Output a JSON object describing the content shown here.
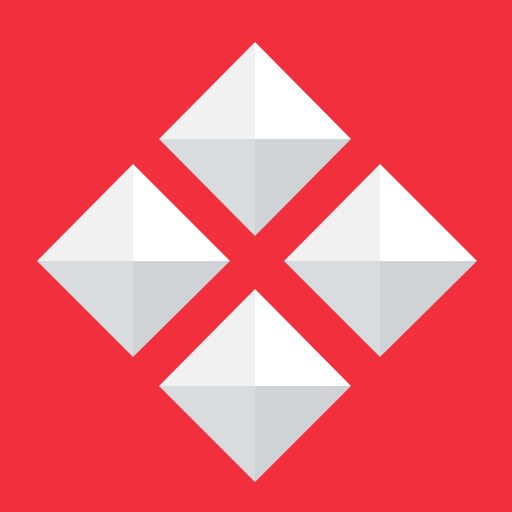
{
  "colors": {
    "background": "#f22f3d",
    "facet_bright": "#ffffff",
    "facet_light": "#f1f1f1",
    "facet_shade": "#d9dcde",
    "facet_shade_dark": "#cfd3d6"
  },
  "icon": {
    "name": "four-diamond-pyramids-logo-icon",
    "diamond_count": 4
  }
}
